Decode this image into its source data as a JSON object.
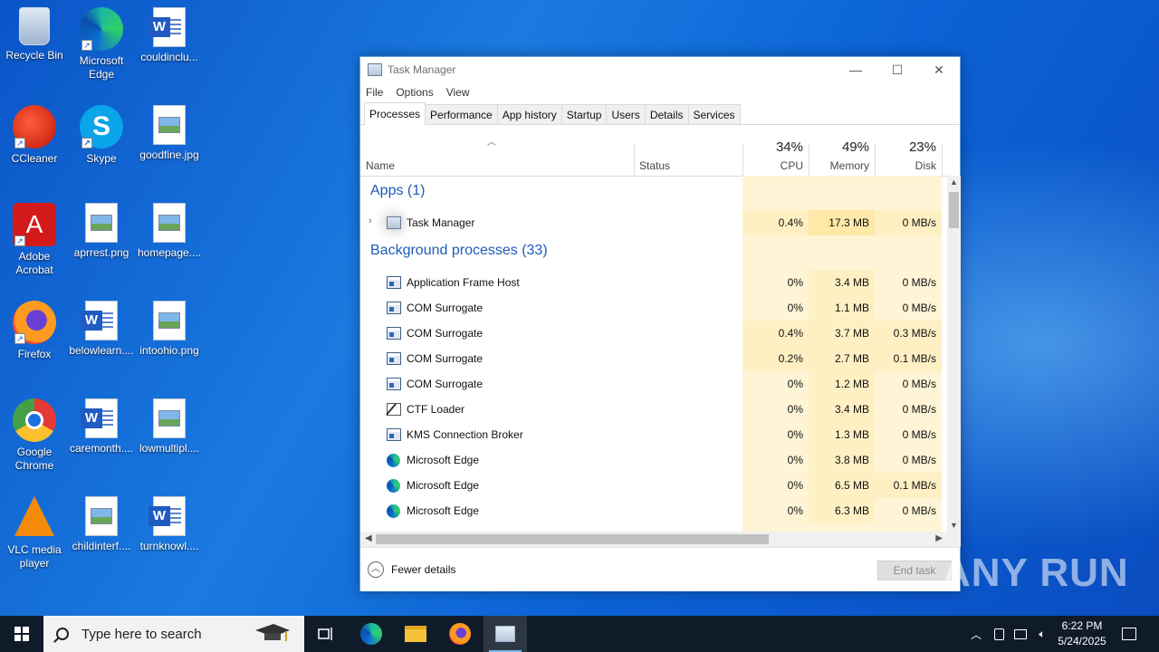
{
  "desktop": {
    "icons": [
      {
        "label": "Recycle Bin"
      },
      {
        "label": "Microsoft Edge"
      },
      {
        "label": "couldinclu..."
      },
      {
        "label": "CCleaner"
      },
      {
        "label": "Skype"
      },
      {
        "label": "goodfine.jpg"
      },
      {
        "label": "Adobe Acrobat"
      },
      {
        "label": "aprrest.png"
      },
      {
        "label": "homepage...."
      },
      {
        "label": "Firefox"
      },
      {
        "label": "belowlearn...."
      },
      {
        "label": "intoohio.png"
      },
      {
        "label": "Google Chrome"
      },
      {
        "label": "caremonth...."
      },
      {
        "label": "lowmultipl...."
      },
      {
        "label": "VLC media player"
      },
      {
        "label": "childinterf...."
      },
      {
        "label": "turnknowl...."
      }
    ]
  },
  "window": {
    "title": "Task Manager",
    "min_glyph": "—",
    "max_glyph": "☐",
    "close_glyph": "✕"
  },
  "menu": [
    "File",
    "Options",
    "View"
  ],
  "tabs": [
    "Processes",
    "Performance",
    "App history",
    "Startup",
    "Users",
    "Details",
    "Services"
  ],
  "columns": {
    "name": "Name",
    "status": "Status",
    "cpu": {
      "pct": "34%",
      "label": "CPU"
    },
    "memory": {
      "pct": "49%",
      "label": "Memory"
    },
    "disk": {
      "pct": "23%",
      "label": "Disk"
    }
  },
  "groups": {
    "apps": "Apps (1)",
    "background": "Background processes (33)"
  },
  "apps": [
    {
      "name": "Task Manager",
      "cpu": "0.4%",
      "memory": "17.3 MB",
      "disk": "0 MB/s",
      "icon": "task-manager-icon"
    }
  ],
  "processes": [
    {
      "name": "Application Frame Host",
      "cpu": "0%",
      "memory": "3.4 MB",
      "disk": "0 MB/s",
      "icon": "frame"
    },
    {
      "name": "COM Surrogate",
      "cpu": "0%",
      "memory": "1.1 MB",
      "disk": "0 MB/s",
      "icon": "frame"
    },
    {
      "name": "COM Surrogate",
      "cpu": "0.4%",
      "memory": "3.7 MB",
      "disk": "0.3 MB/s",
      "icon": "frame"
    },
    {
      "name": "COM Surrogate",
      "cpu": "0.2%",
      "memory": "2.7 MB",
      "disk": "0.1 MB/s",
      "icon": "frame"
    },
    {
      "name": "COM Surrogate",
      "cpu": "0%",
      "memory": "1.2 MB",
      "disk": "0 MB/s",
      "icon": "frame"
    },
    {
      "name": "CTF Loader",
      "cpu": "0%",
      "memory": "3.4 MB",
      "disk": "0 MB/s",
      "icon": "ctf"
    },
    {
      "name": "KMS Connection Broker",
      "cpu": "0%",
      "memory": "1.3 MB",
      "disk": "0 MB/s",
      "icon": "frame"
    },
    {
      "name": "Microsoft Edge",
      "cpu": "0%",
      "memory": "3.8 MB",
      "disk": "0 MB/s",
      "icon": "edge"
    },
    {
      "name": "Microsoft Edge",
      "cpu": "0%",
      "memory": "6.5 MB",
      "disk": "0.1 MB/s",
      "icon": "edge"
    },
    {
      "name": "Microsoft Edge",
      "cpu": "0%",
      "memory": "6.3 MB",
      "disk": "0 MB/s",
      "icon": "edge"
    }
  ],
  "footer": {
    "fewer_details": "Fewer details",
    "end_task": "End task"
  },
  "taskbar": {
    "search_placeholder": "Type here to search",
    "time": "6:22 PM",
    "date": "5/24/2025"
  },
  "watermark": "ANY RUN"
}
